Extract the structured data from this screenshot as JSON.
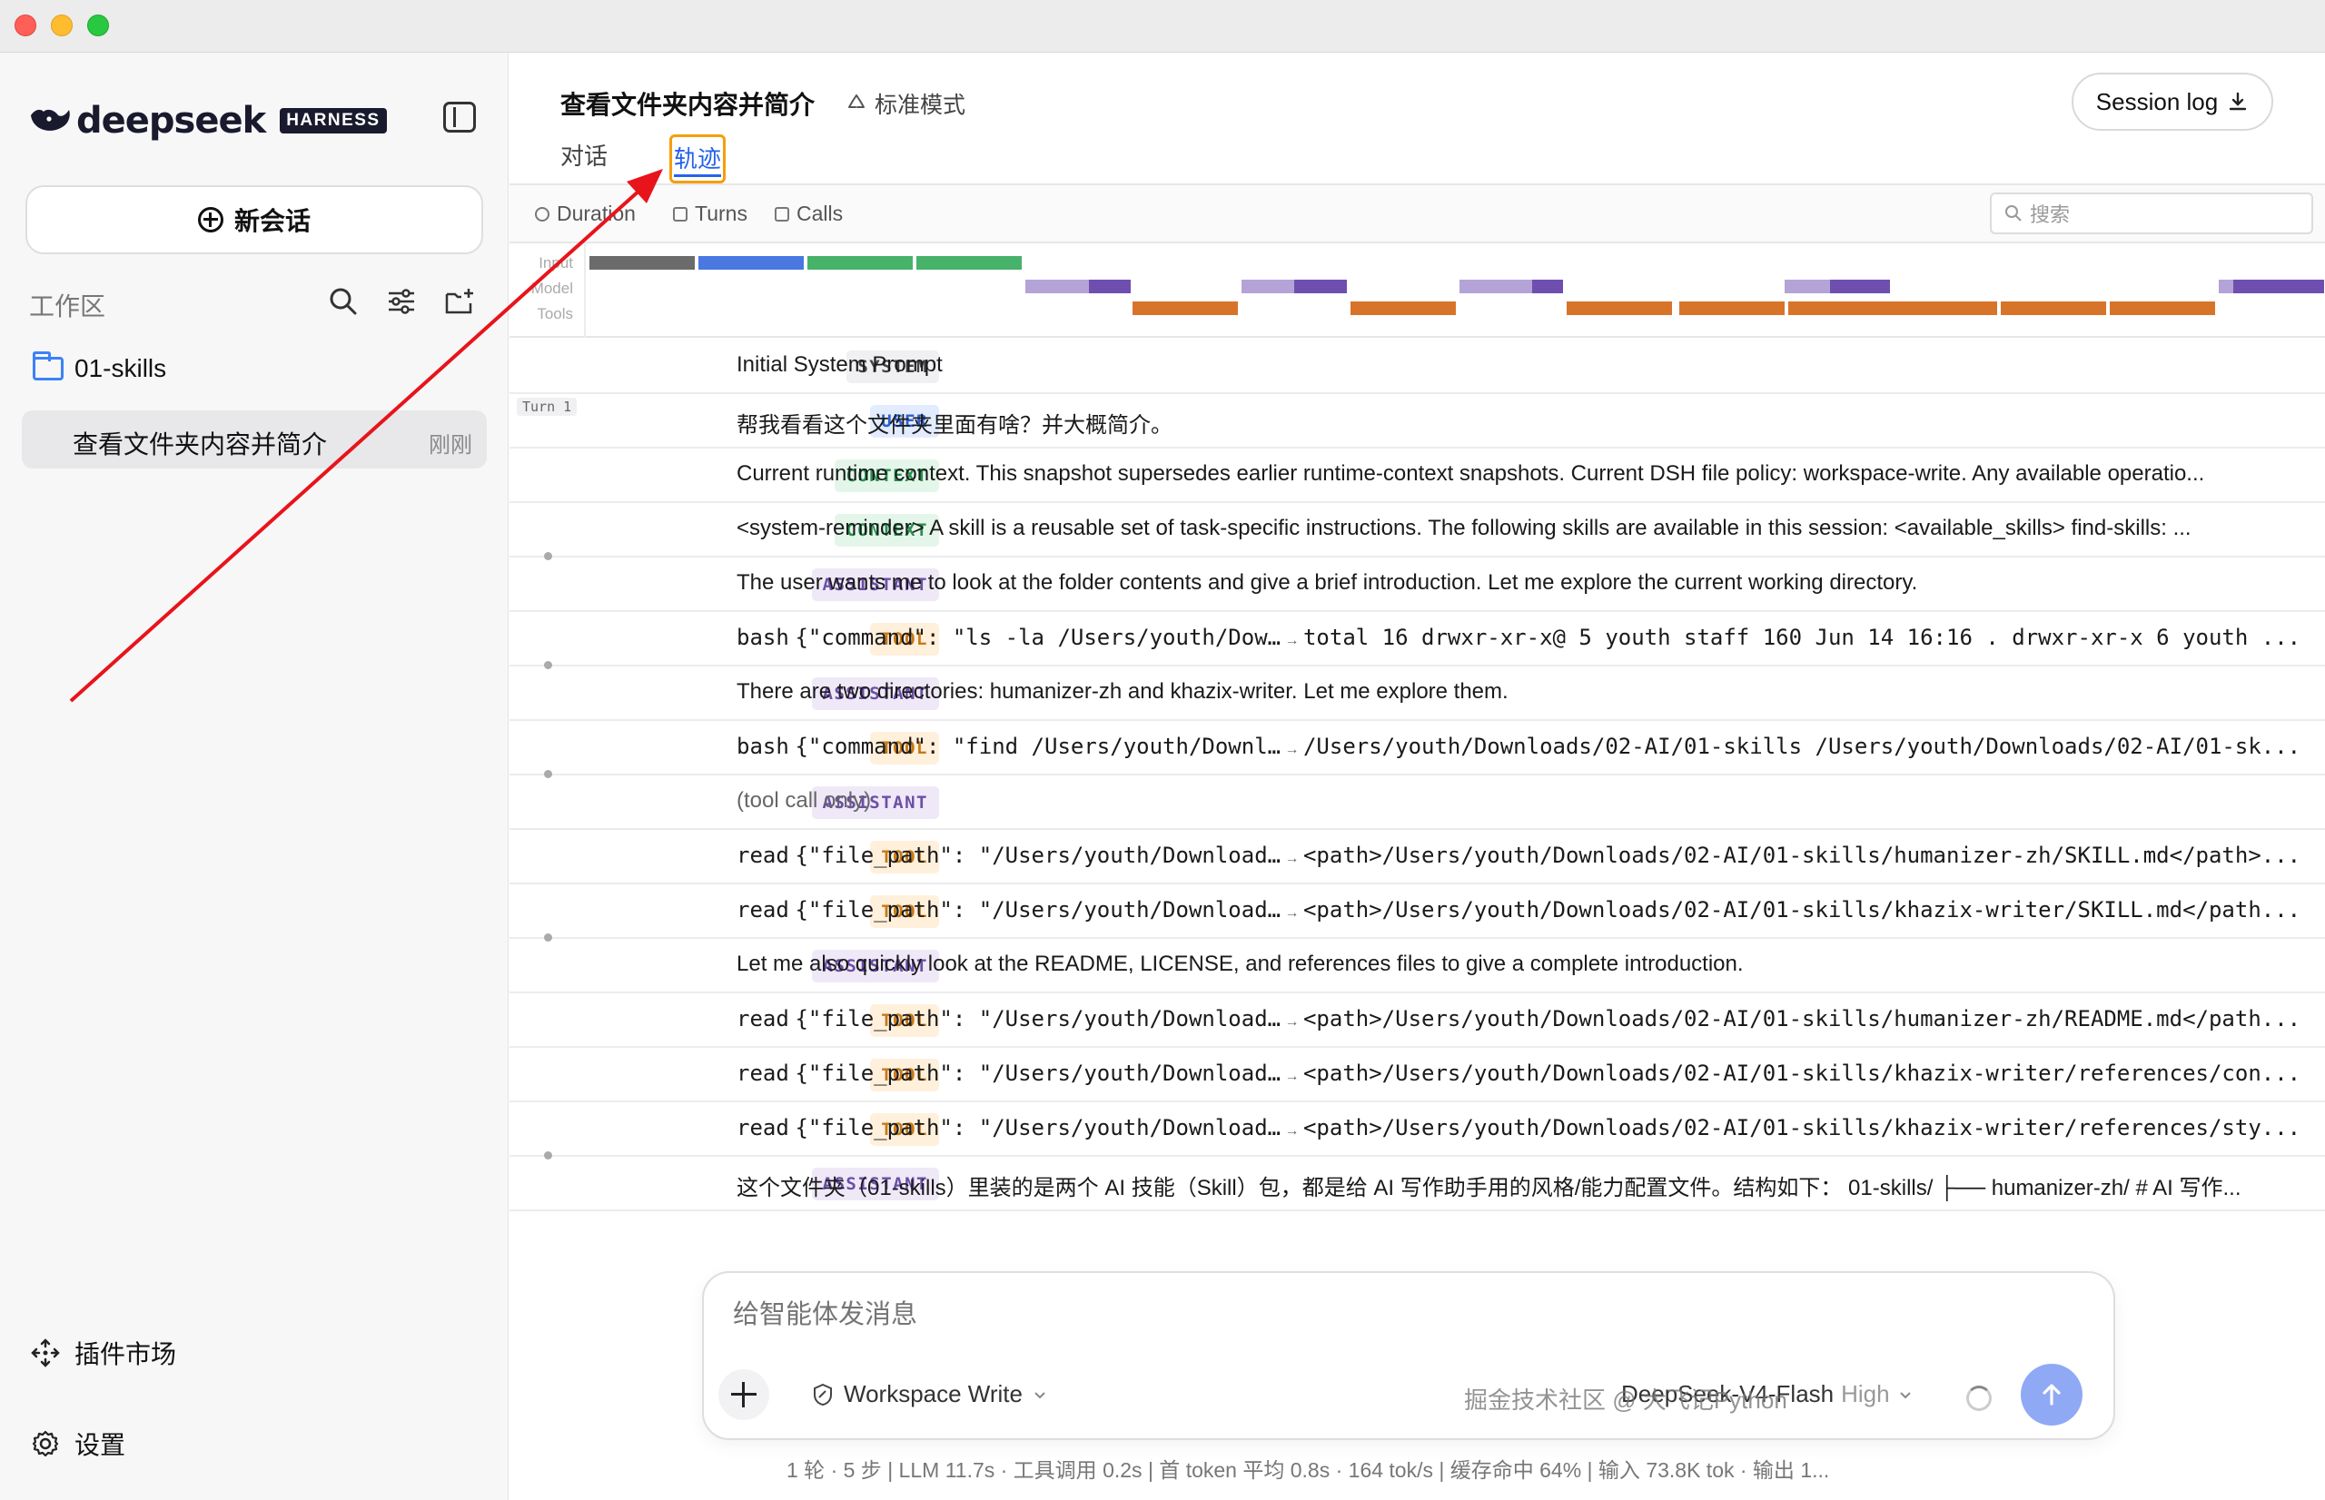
{
  "app": {
    "logo_text": "deepseek",
    "logo_badge": "HARNESS"
  },
  "sidebar": {
    "new_chat_label": "新会话",
    "workspace_label": "工作区",
    "folder_name": "01-skills",
    "session": {
      "title": "查看文件夹内容并简介",
      "time": "刚刚"
    },
    "plugin_market_label": "插件市场",
    "settings_label": "设置"
  },
  "header": {
    "title": "查看文件夹内容并简介",
    "mode_label": "标准模式",
    "session_log_label": "Session log",
    "tabs": [
      {
        "label": "对话"
      },
      {
        "label": "轨迹"
      }
    ]
  },
  "toolbar": {
    "duration_label": "Duration",
    "turns_label": "Turns",
    "calls_label": "Calls",
    "search_placeholder": "搜索"
  },
  "timeline": {
    "lanes": [
      "Input",
      "Model",
      "Tools"
    ],
    "colors": {
      "input_gray": "#6b6b6b",
      "input_blue": "#4a78e0",
      "input_green": "#47b26a",
      "model_light": "#b4a3d6",
      "model_dark": "#6e4fb0",
      "tool": "#d8742a"
    }
  },
  "trace": {
    "turn_label": "Turn 1",
    "rows": [
      {
        "role": "SYSTEM",
        "text": "Initial System Prompt"
      },
      {
        "role": "USER",
        "text": "帮我看看这个文件夹里面有啥？并大概简介。"
      },
      {
        "role": "CONTEXT",
        "text": "Current runtime context. This snapshot supersedes earlier runtime-context snapshots. Current DSH file policy: workspace-write. Any available operatio..."
      },
      {
        "role": "CONTEXT",
        "text": "<system-reminder> A skill is a reusable set of task-specific instructions. The following skills are available in this session: <available_skills> find-skills: ..."
      },
      {
        "role": "ASSISTANT",
        "text": "The user wants me to look at the folder contents and give a brief introduction. Let me explore the current working directory."
      },
      {
        "role": "TOOL",
        "tool": "bash",
        "args": "{\"command\": \"ls -la /Users/youth/Dow…",
        "result": "total 16 drwxr-xr-x@ 5 youth staff 160 Jun 14 16:16 . drwxr-xr-x 6 youth ..."
      },
      {
        "role": "ASSISTANT",
        "text": "There are two directories: humanizer-zh and khazix-writer. Let me explore them."
      },
      {
        "role": "TOOL",
        "tool": "bash",
        "args": "{\"command\": \"find /Users/youth/Downl…",
        "result": "/Users/youth/Downloads/02-AI/01-skills /Users/youth/Downloads/02-AI/01-sk..."
      },
      {
        "role": "ASSISTANT",
        "text": "(tool call only)"
      },
      {
        "role": "TOOL",
        "tool": "read",
        "args": "{\"file_path\": \"/Users/youth/Download…",
        "result": "<path>/Users/youth/Downloads/02-AI/01-skills/humanizer-zh/SKILL.md</path>..."
      },
      {
        "role": "TOOL",
        "tool": "read",
        "args": "{\"file_path\": \"/Users/youth/Download…",
        "result": "<path>/Users/youth/Downloads/02-AI/01-skills/khazix-writer/SKILL.md</path..."
      },
      {
        "role": "ASSISTANT",
        "text": "Let me also quickly look at the README, LICENSE, and references files to give a complete introduction."
      },
      {
        "role": "TOOL",
        "tool": "read",
        "args": "{\"file_path\": \"/Users/youth/Download…",
        "result": "<path>/Users/youth/Downloads/02-AI/01-skills/humanizer-zh/README.md</path..."
      },
      {
        "role": "TOOL",
        "tool": "read",
        "args": "{\"file_path\": \"/Users/youth/Download…",
        "result": "<path>/Users/youth/Downloads/02-AI/01-skills/khazix-writer/references/con..."
      },
      {
        "role": "TOOL",
        "tool": "read",
        "args": "{\"file_path\": \"/Users/youth/Download…",
        "result": "<path>/Users/youth/Downloads/02-AI/01-skills/khazix-writer/references/sty..."
      },
      {
        "role": "ASSISTANT",
        "text": "这个文件夹（01-skills）里装的是两个 AI 技能（Skill）包，都是给 AI 写作助手用的风格/能力配置文件。结构如下：  01-skills/ ├── humanizer-zh/ # AI 写作..."
      }
    ]
  },
  "composer": {
    "placeholder": "给智能体发消息",
    "workspace_mode": "Workspace Write",
    "model_name": "DeepSeek-V4-Flash",
    "model_level": "High"
  },
  "stats_bar": "1 轮 · 5 步  |  LLM 11.7s · 工具调用 0.2s  |  首 token 平均 0.8s · 164 tok/s  |  缓存命中 64%  |  输入 73.8K tok · 输出 1...",
  "watermark": "掘金技术社区 @ 大飞记Python",
  "annotation": {
    "arrow_color": "#e8141b"
  }
}
